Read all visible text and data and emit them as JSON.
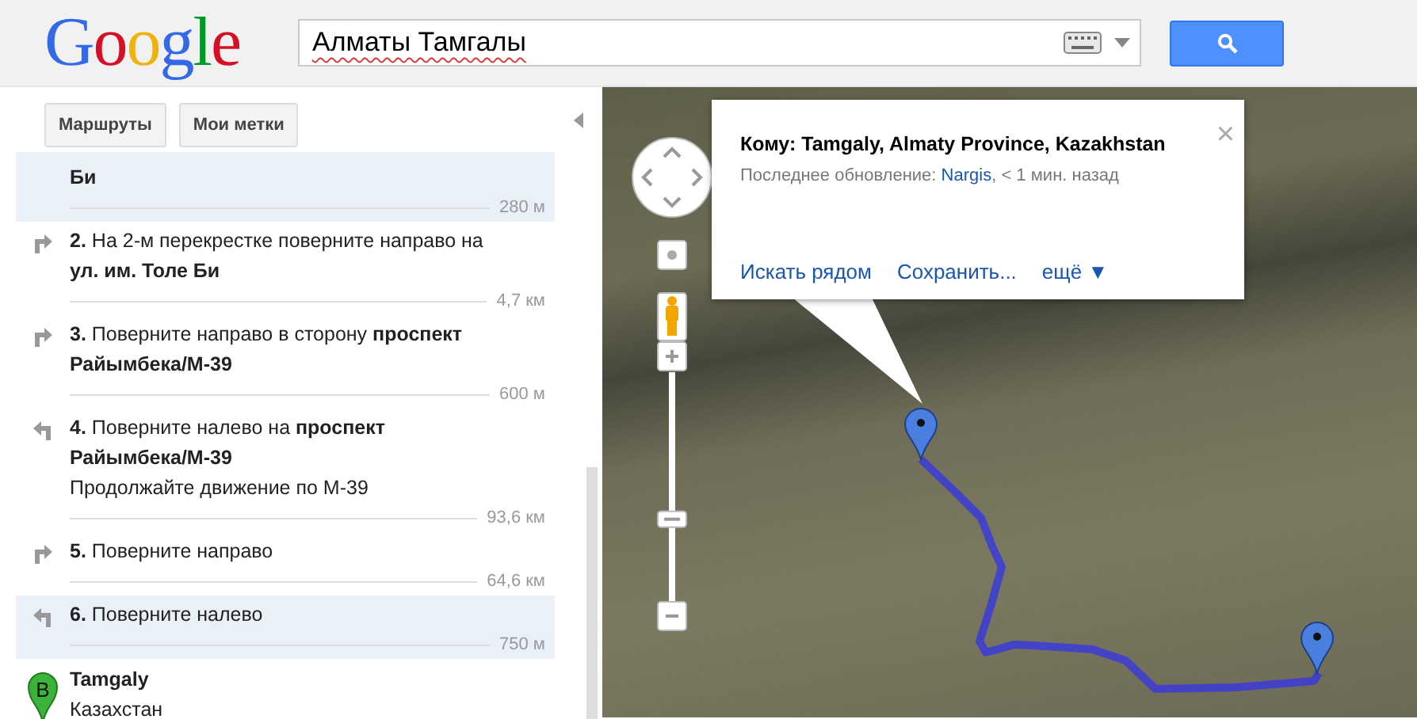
{
  "header": {
    "logo": "Google",
    "search": {
      "value": "Алматы Тамгалы"
    }
  },
  "panel_buttons": [
    "Маршруты",
    "Мои метки"
  ],
  "steps": [
    {
      "kind": "partial",
      "text": "Би",
      "distance": "280 м",
      "selected": true
    },
    {
      "kind": "right",
      "number": "2.",
      "text": "На 2-м перекрестке поверните направо на **ул. им. Толе Би**",
      "distance": "4,7 км",
      "selected": false
    },
    {
      "kind": "right",
      "number": "3.",
      "text": "Поверните направо в сторону **проспект Райымбека/М-39**",
      "distance": "600 м",
      "selected": false
    },
    {
      "kind": "left",
      "number": "4.",
      "text": "Поверните налево на **проспект Райымбека/М-39**",
      "note": "Продолжайте движение по М-39",
      "distance": "93,6 км",
      "selected": false
    },
    {
      "kind": "right",
      "number": "5.",
      "text": "Поверните направо",
      "distance": "64,6 км",
      "selected": false
    },
    {
      "kind": "left",
      "number": "6.",
      "text": "Поверните налево",
      "distance": "750 м",
      "selected": true
    }
  ],
  "destination": {
    "marker": "B",
    "name": "Tamgaly",
    "country": "Казахстан"
  },
  "info_window": {
    "title": "Кому: Tamgaly, Almaty Province, Kazakhstan",
    "close": "×",
    "updated_prefix": "Последнее обновление:",
    "updated_by": "Nargis",
    "updated_suffix": ", < 1 мин. назад",
    "links": [
      "Искать рядом",
      "Сохранить...",
      "ещё ▼"
    ]
  },
  "zoom": {
    "level": 0.38
  }
}
